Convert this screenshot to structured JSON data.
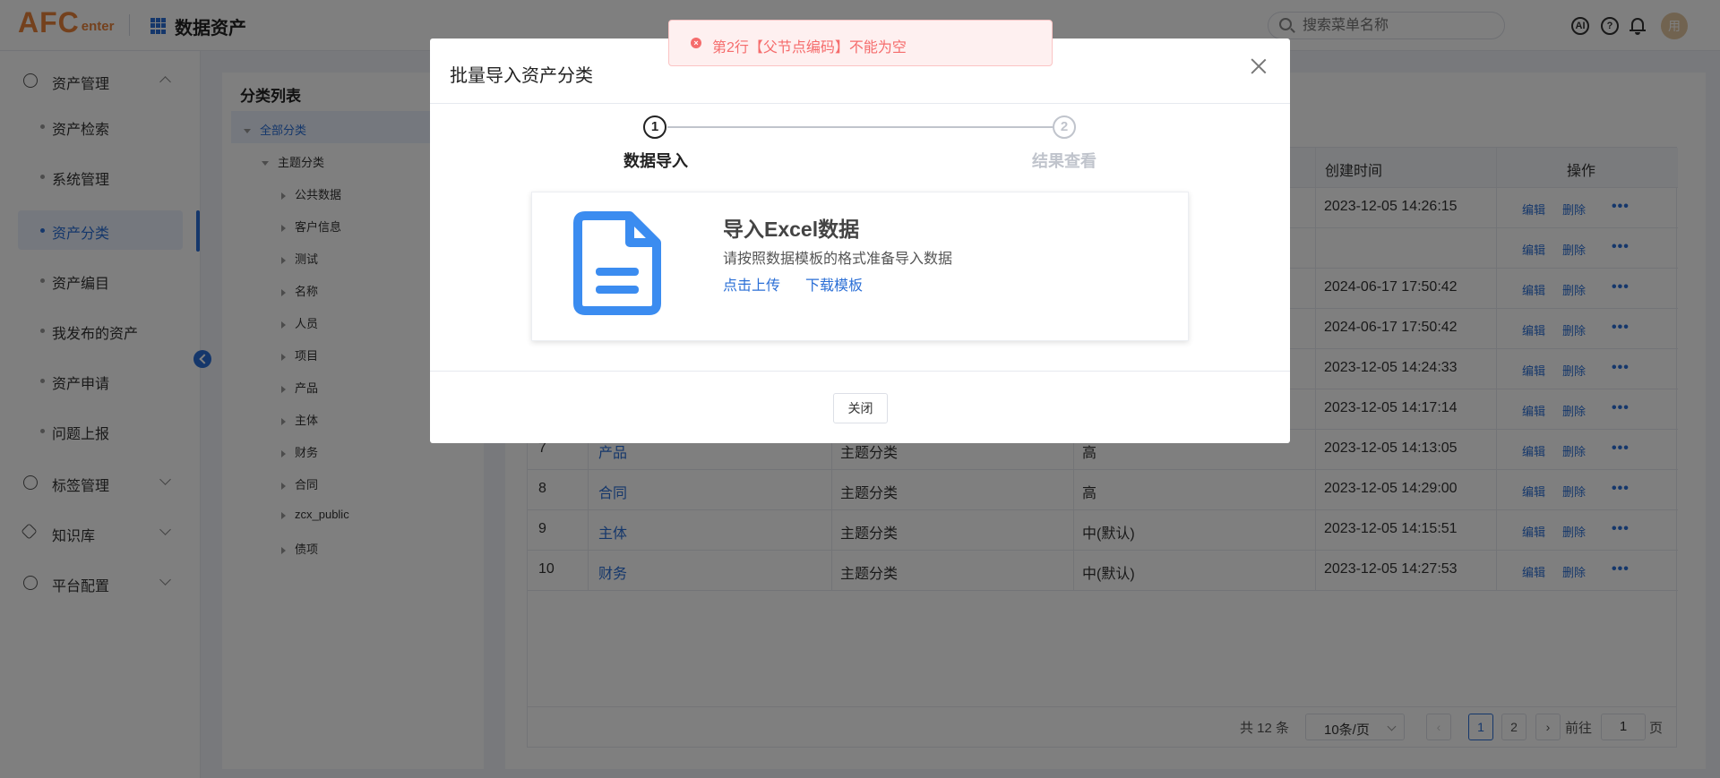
{
  "header": {
    "logo_main": "AFC",
    "logo_sub": "enter",
    "app_title": "数据资产",
    "search_placeholder": "搜索菜单名称",
    "ai_icon_text": "AI",
    "help_icon_text": "?",
    "avatar_text": "用"
  },
  "sidebar": {
    "groups": [
      {
        "label": "资产管理"
      },
      {
        "label": "标签管理"
      },
      {
        "label": "知识库"
      },
      {
        "label": "平台配置"
      }
    ],
    "items": [
      {
        "label": "资产检索"
      },
      {
        "label": "系统管理"
      },
      {
        "label": "资产分类"
      },
      {
        "label": "资产编目"
      },
      {
        "label": "我发布的资产"
      },
      {
        "label": "资产申请"
      },
      {
        "label": "问题上报"
      }
    ]
  },
  "tree": {
    "title": "分类列表",
    "root": "全部分类",
    "group": "主题分类",
    "children": [
      "公共数据",
      "客户信息",
      "测试",
      "名称",
      "人员",
      "项目",
      "产品",
      "主体",
      "财务",
      "合同",
      "zcx_public",
      "债项"
    ]
  },
  "table": {
    "headers": {
      "created": "创建时间",
      "ops": "操作"
    },
    "actions": {
      "edit": "编辑",
      "delete": "删除",
      "more": "•••"
    },
    "rows": [
      {
        "no": "",
        "name": "",
        "type": "",
        "level": "",
        "created": "2023-12-05 14:26:15"
      },
      {
        "no": "",
        "name": "",
        "type": "",
        "level": "",
        "created": ""
      },
      {
        "no": "",
        "name": "",
        "type": "",
        "level": "",
        "created": "2024-06-17 17:50:42"
      },
      {
        "no": "",
        "name": "",
        "type": "",
        "level": "",
        "created": "2024-06-17 17:50:42"
      },
      {
        "no": "",
        "name": "",
        "type": "",
        "level": "",
        "created": "2023-12-05 14:24:33"
      },
      {
        "no": "",
        "name": "",
        "type": "",
        "level": "",
        "created": "2023-12-05 14:17:14"
      },
      {
        "no": "7",
        "name": "产品",
        "type": "主题分类",
        "level": "高",
        "created": "2023-12-05 14:13:05"
      },
      {
        "no": "8",
        "name": "合同",
        "type": "主题分类",
        "level": "高",
        "created": "2023-12-05 14:29:00"
      },
      {
        "no": "9",
        "name": "主体",
        "type": "主题分类",
        "level": "中(默认)",
        "created": "2023-12-05 14:15:51"
      },
      {
        "no": "10",
        "name": "财务",
        "type": "主题分类",
        "level": "中(默认)",
        "created": "2023-12-05 14:27:53"
      }
    ]
  },
  "pager": {
    "total": "共 12 条",
    "page_size": "10条/页",
    "prev": "‹",
    "next": "›",
    "pages": [
      "1",
      "2"
    ],
    "goto_label": "前往",
    "goto_value": "1",
    "goto_unit": "页"
  },
  "dialog": {
    "title": "批量导入资产分类",
    "steps": [
      {
        "num": "1",
        "label": "数据导入"
      },
      {
        "num": "2",
        "label": "结果查看"
      }
    ],
    "card_title": "导入Excel数据",
    "card_desc": "请按照数据模板的格式准备导入数据",
    "upload_link": "点击上传",
    "template_link": "下载模板",
    "close_button": "关闭"
  },
  "toast": {
    "icon_text": "×",
    "message": "第2行【父节点编码】不能为空"
  },
  "colors": {
    "accent": "#2b6fd6",
    "logo": "#e8823a",
    "error": "#f56c6c"
  }
}
